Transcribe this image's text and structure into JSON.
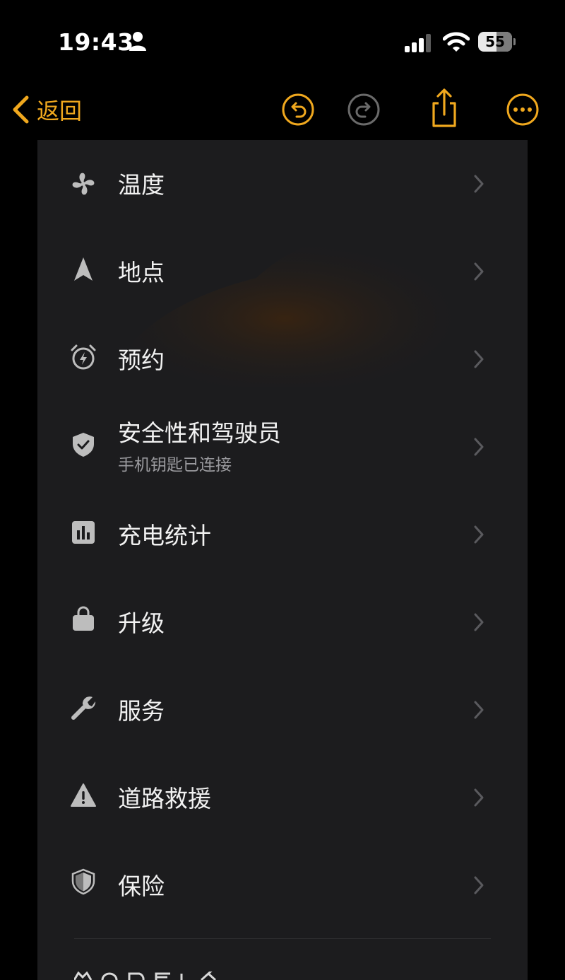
{
  "status_bar": {
    "time": "19:43",
    "battery_level": "55",
    "icons": [
      "person-icon",
      "cellular-signal-icon",
      "wifi-icon",
      "battery-icon"
    ]
  },
  "nav": {
    "back_label": "返回",
    "actions": [
      "undo-icon",
      "redo-icon",
      "share-icon",
      "more-icon"
    ],
    "accent_color": "#f0a81e"
  },
  "menu": {
    "items": [
      {
        "label": "温度",
        "icon": "fan-icon"
      },
      {
        "label": "地点",
        "icon": "location-arrow-icon"
      },
      {
        "label": "预约",
        "icon": "alarm-clock-icon"
      },
      {
        "label": "安全性和驾驶员",
        "subtitle": "手机钥匙已连接",
        "icon": "shield-check-icon"
      },
      {
        "label": "充电统计",
        "icon": "bar-chart-icon"
      },
      {
        "label": "升级",
        "icon": "shopping-bag-icon"
      },
      {
        "label": "服务",
        "icon": "wrench-icon"
      },
      {
        "label": "道路救援",
        "icon": "warning-triangle-icon"
      },
      {
        "label": "保险",
        "icon": "shield-icon"
      }
    ]
  },
  "colors": {
    "background": "#000000",
    "panel": "#1c1c1e",
    "text": "#f2f2f2",
    "subtext": "#9a9a9e",
    "icon": "#bdbdbd",
    "chevron": "#5a5a5e"
  }
}
